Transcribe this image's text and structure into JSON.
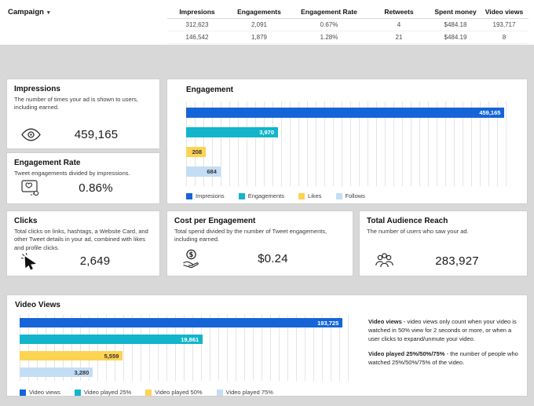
{
  "header": {
    "campaign_label": "Campaign",
    "table": {
      "columns": [
        "Impresions",
        "Engagements",
        "Engagement Rate",
        "Retweets",
        "Spent money",
        "Video views"
      ],
      "rows": [
        [
          "312,623",
          "2,091",
          "0.67%",
          "4",
          "$484.18",
          "193,717"
        ],
        [
          "146,542",
          "1,879",
          "1.28%",
          "21",
          "$484.19",
          "8"
        ]
      ]
    }
  },
  "cards": {
    "impressions": {
      "title": "Impressions",
      "description": "The number of times your ad is shown to users, including earned.",
      "icon": "eye-icon",
      "value": "459,165"
    },
    "engagement_rate": {
      "title": "Engagement Rate",
      "description": "Tweet engagements divided by impressions.",
      "icon": "engagement-rate-icon",
      "value": "0.86%"
    },
    "clicks": {
      "title": "Clicks",
      "description": "Total clicks on links, hashtags, a Website Card, and other Tweet details in your ad, combined with likes and profile clicks.",
      "icon": "cursor-icon",
      "value": "2,649"
    },
    "cost_per_engagement": {
      "title": "Cost per Engagement",
      "description": "Total spend divided by the number of Tweet engagements, including earned.",
      "icon": "coin-hand-icon",
      "value": "$0.24"
    },
    "total_audience_reach": {
      "title": "Total Audience Reach",
      "description": "The number of users who saw your ad.",
      "icon": "audience-icon",
      "value": "283,927"
    }
  },
  "chart_data": [
    {
      "type": "bar",
      "orientation": "horizontal",
      "title": "Engagement",
      "categories": [
        "Impresions",
        "Engagements",
        "Likes",
        "Follows"
      ],
      "values": [
        459165,
        3970,
        208,
        684
      ],
      "value_labels": [
        "459,165",
        "3,970",
        "208",
        "684"
      ],
      "colors": [
        "#1565d8",
        "#12b5cb",
        "#fcd353",
        "#c3ddf4"
      ],
      "label_colors": [
        "#ffffff",
        "#ffffff",
        "#333333",
        "#333333"
      ],
      "bar_widths_pct": [
        97,
        28,
        6,
        10.5
      ],
      "scale": "log",
      "grid": true,
      "legend_position": "bottom"
    },
    {
      "type": "bar",
      "orientation": "horizontal",
      "title": "Video Views",
      "categories": [
        "Video views",
        "Video played 25%",
        "Video played 50%",
        "Video played 75%"
      ],
      "values": [
        193725,
        19861,
        5559,
        3280
      ],
      "value_labels": [
        "193,725",
        "19,861",
        "5,559",
        "3,280"
      ],
      "colors": [
        "#1565d8",
        "#12b5cb",
        "#fcd353",
        "#c3ddf4"
      ],
      "label_colors": [
        "#ffffff",
        "#ffffff",
        "#333333",
        "#333333"
      ],
      "bar_widths_pct": [
        97,
        55,
        31,
        22
      ],
      "scale": "log",
      "grid": true,
      "legend_position": "bottom"
    }
  ],
  "video_notes": {
    "p1_bold": "Video views",
    "p1_text": " - video views only count when your video is watched in 50% view for 2 seconds or more, or when a user clicks to expand/unmute your video.",
    "p2_bold": "Video played 25%/50%/75%",
    "p2_text": " - the number of people who watched 25%/50%/75% of the video."
  }
}
